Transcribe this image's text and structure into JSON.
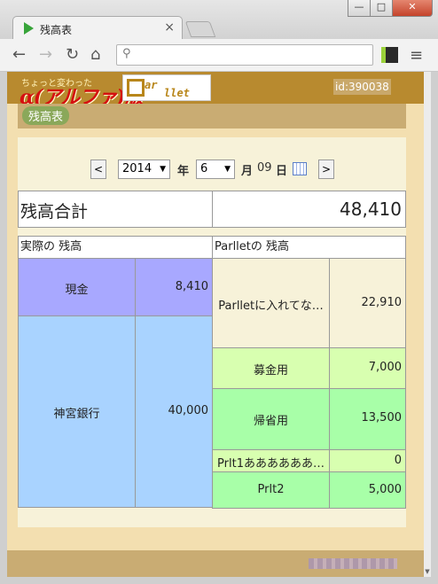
{
  "browser": {
    "tab_title": "残高表",
    "address": "",
    "minimize": "—",
    "maximize": "□",
    "close": "✕"
  },
  "header": {
    "logo_sub": "ちょっと変わった",
    "logo_main": "α(アルファ)版",
    "parllet_logo_1": "ar",
    "parllet_logo_2": "llet",
    "user_id": "id:390038"
  },
  "breadcrumb": {
    "label": "残高表"
  },
  "date_nav": {
    "prev": "<",
    "next": ">",
    "year": "2014",
    "year_label": "年",
    "month": "6",
    "month_label": "月",
    "day": "09",
    "day_label": "日"
  },
  "total": {
    "label": "残高合計",
    "value": "48,410"
  },
  "real_header": "実際の 残高",
  "parllet_header": "Parlletの 残高",
  "real": [
    {
      "name": "現金",
      "amount": "8,410"
    },
    {
      "name": "神宮銀行",
      "amount": "40,000"
    }
  ],
  "parllet": [
    {
      "name": "Parlletに入れてな…",
      "amount": "22,910",
      "color": "#f7f2d9"
    },
    {
      "name": "募金用",
      "amount": "7,000",
      "color": "#d8ffb0"
    },
    {
      "name": "帰省用",
      "amount": "13,500",
      "color": "#a8ffa8"
    },
    {
      "name": "Prlt1ああああああ…",
      "amount": "0",
      "color": "#d8ffb0"
    },
    {
      "name": "Prlt2",
      "amount": "5,000",
      "color": "#a8ffa8"
    }
  ]
}
